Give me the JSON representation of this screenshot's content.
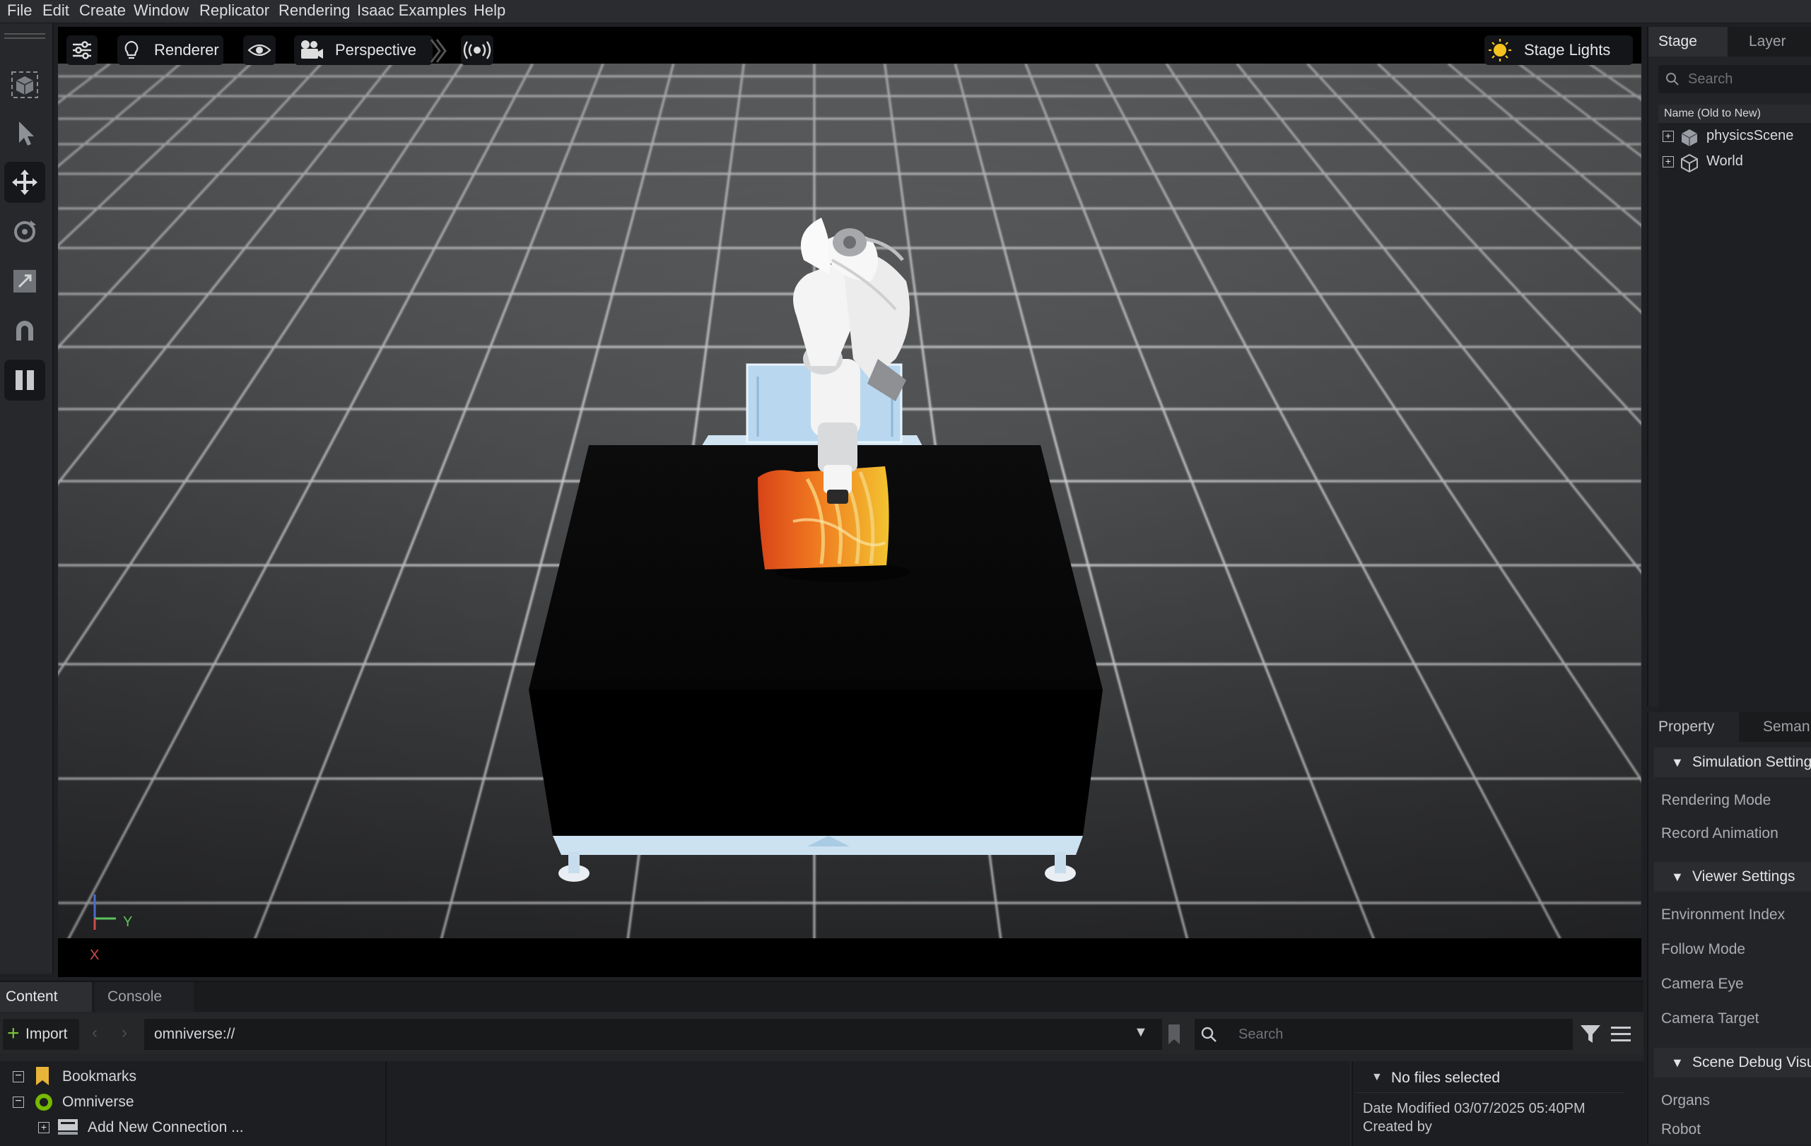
{
  "menu": [
    "File",
    "Edit",
    "Create",
    "Window",
    "Replicator",
    "Rendering",
    "Isaac Examples",
    "Help"
  ],
  "viewport": {
    "renderer_label": "Renderer",
    "camera_label": "Perspective",
    "stage_lights_label": "Stage Lights",
    "axis_y": "Y",
    "axis_x": "X"
  },
  "stage": {
    "tabs": [
      "Stage",
      "Layer"
    ],
    "search_placeholder": "Search",
    "column_header": "Name (Old to New)",
    "items": [
      {
        "label": "physicsScene",
        "icon": "prim-cube-icon"
      },
      {
        "label": "World",
        "icon": "xform-cube-icon"
      }
    ]
  },
  "properties": {
    "tabs": [
      "Property",
      "Seman"
    ],
    "sections": [
      {
        "title": "Simulation Setting",
        "rows": [
          "Rendering Mode",
          "Record Animation"
        ]
      },
      {
        "title": "Viewer Settings",
        "rows": [
          "Environment Index",
          "Follow Mode",
          "Camera Eye",
          "Camera Target"
        ]
      },
      {
        "title": "Scene Debug Visu",
        "rows": [
          "Organs",
          "Robot"
        ]
      }
    ]
  },
  "content": {
    "tabs": [
      "Content",
      "Console"
    ],
    "import_label": "Import",
    "path": "omniverse://",
    "search_placeholder": "Search",
    "tree": [
      "Bookmarks",
      "Omniverse",
      "Add New Connection ..."
    ],
    "info_title": "No files selected",
    "date_modified": "Date Modified 03/07/2025 05:40PM",
    "created_by": "Created by"
  },
  "colors": {
    "accent_green": "#76b900",
    "bookmark_yellow": "#e8b339",
    "table_blue": "#bcd9ee",
    "organ_orange": "#e86a1c"
  }
}
